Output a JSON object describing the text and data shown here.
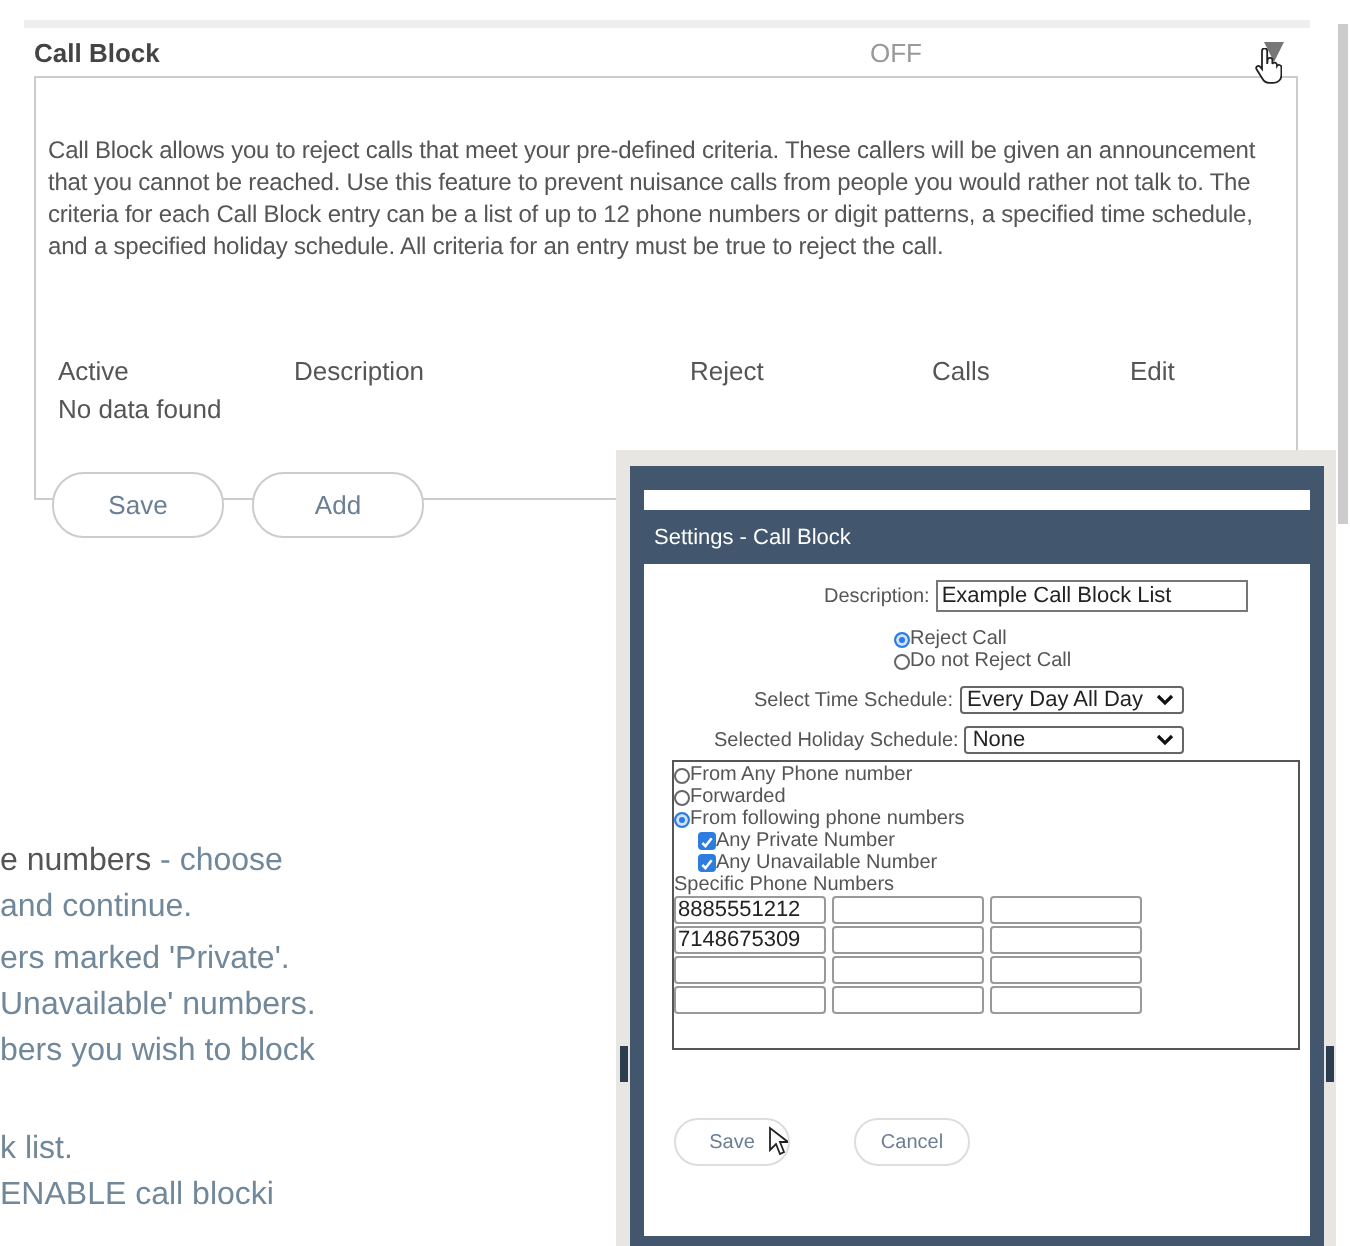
{
  "panel": {
    "title": "Call Block",
    "status": "OFF",
    "expanded": true,
    "description": "Call Block allows you to reject calls that meet your pre-defined criteria. These callers will be given an announcement that you cannot be reached. Use this feature to prevent nuisance calls from people you would rather not talk to. The criteria for each Call Block entry can be a list of up to 12 phone numbers or digit patterns, a specified time schedule, and a specified holiday schedule. All criteria for an entry must be true to reject the call.",
    "table": {
      "columns": [
        "Active",
        "Description",
        "Reject",
        "Calls",
        "Edit"
      ],
      "empty_text": "No data found"
    },
    "buttons": [
      "Save",
      "Add"
    ]
  },
  "instructions": [
    {
      "parts": [
        {
          "text": "e numbers",
          "emphasis": true
        },
        {
          "text": " - choose",
          "emphasis": false
        }
      ]
    },
    {
      "parts": [
        {
          "text": "and continue.",
          "emphasis": false
        }
      ]
    },
    {
      "parts": [
        {
          "text": "ers marked 'Private'.",
          "emphasis": false
        }
      ]
    },
    {
      "parts": [
        {
          "text": "Unavailable' numbers.",
          "emphasis": false
        }
      ]
    },
    {
      "parts": [
        {
          "text": "bers you wish to block",
          "emphasis": false
        }
      ]
    },
    {
      "parts": [
        {
          "text": "k list.",
          "emphasis": false
        }
      ]
    },
    {
      "parts": [
        {
          "text": "ENABLE call blocki",
          "emphasis": false
        }
      ]
    }
  ],
  "dialog": {
    "title": "Settings - Call Block",
    "description_label": "Description:",
    "description_value": "Example Call Block List",
    "reject_options": [
      {
        "label": "Reject Call",
        "selected": true
      },
      {
        "label": "Do not Reject Call",
        "selected": false
      }
    ],
    "time_schedule_label": "Select Time Schedule:",
    "time_schedule_value": "Every Day All Day",
    "holiday_schedule_label": "Selected Holiday Schedule:",
    "holiday_schedule_value": "None",
    "source_options": [
      {
        "label": "From Any Phone number",
        "selected": false
      },
      {
        "label": "Forwarded",
        "selected": false
      },
      {
        "label": "From following phone numbers",
        "selected": true
      }
    ],
    "checkboxes": [
      {
        "label": "Any Private Number",
        "checked": true
      },
      {
        "label": "Any Unavailable Number",
        "checked": true
      }
    ],
    "numbers_label": "Specific Phone Numbers",
    "numbers": [
      "8885551212",
      "7148675309"
    ],
    "buttons": [
      "Save",
      "Cancel"
    ]
  }
}
